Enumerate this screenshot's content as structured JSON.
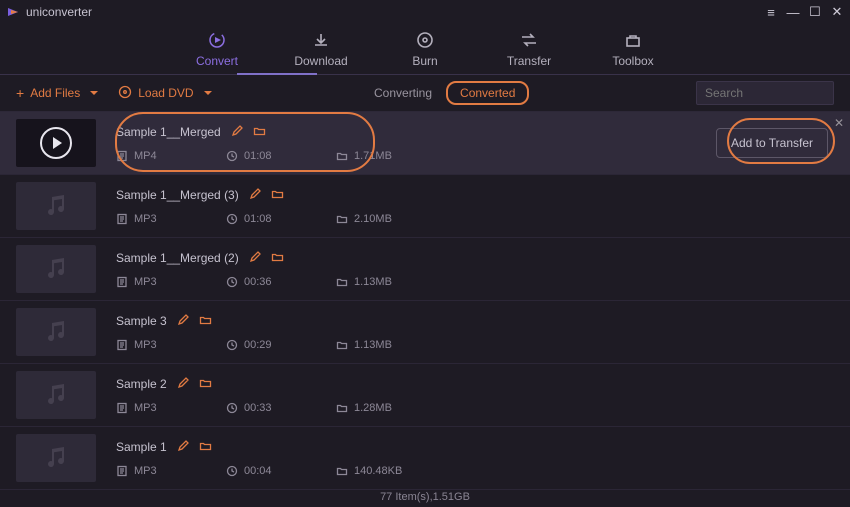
{
  "app": {
    "title": "uniconverter"
  },
  "window": {
    "hamburger": "≡",
    "minimize": "—",
    "maximize": "☐",
    "close": "✕"
  },
  "nav": {
    "convert": "Convert",
    "download": "Download",
    "burn": "Burn",
    "transfer": "Transfer",
    "toolbox": "Toolbox"
  },
  "subbar": {
    "add_files": "Add Files",
    "load_dvd": "Load DVD",
    "tab_converting": "Converting",
    "tab_converted": "Converted"
  },
  "search": {
    "placeholder": "Search"
  },
  "actions": {
    "add_to_transfer": "Add to Transfer"
  },
  "rows": [
    {
      "name": "Sample 1__Merged",
      "fmt": "MP4",
      "dur": "01:08",
      "size": "1.71MB",
      "kind": "video",
      "selected": true
    },
    {
      "name": "Sample 1__Merged (3)",
      "fmt": "MP3",
      "dur": "01:08",
      "size": "2.10MB",
      "kind": "audio",
      "selected": false
    },
    {
      "name": "Sample 1__Merged (2)",
      "fmt": "MP3",
      "dur": "00:36",
      "size": "1.13MB",
      "kind": "audio",
      "selected": false
    },
    {
      "name": "Sample 3",
      "fmt": "MP3",
      "dur": "00:29",
      "size": "1.13MB",
      "kind": "audio",
      "selected": false
    },
    {
      "name": "Sample 2",
      "fmt": "MP3",
      "dur": "00:33",
      "size": "1.28MB",
      "kind": "audio",
      "selected": false
    },
    {
      "name": "Sample 1",
      "fmt": "MP3",
      "dur": "00:04",
      "size": "140.48KB",
      "kind": "audio",
      "selected": false
    }
  ],
  "status": {
    "summary": "77 Item(s),1.51GB"
  }
}
